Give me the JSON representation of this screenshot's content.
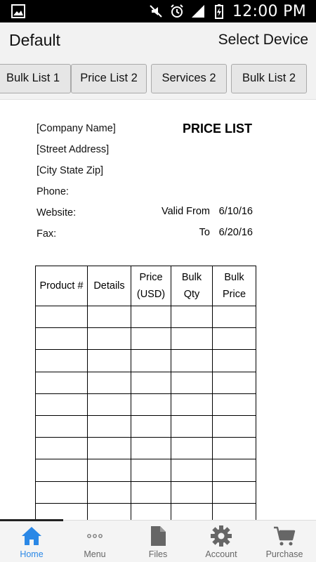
{
  "status_bar": {
    "time": "12:00 PM",
    "icons": [
      "image-icon",
      "mute-icon",
      "alarm-icon",
      "signal-icon",
      "battery-charging-icon"
    ]
  },
  "header": {
    "title": "Default",
    "select_device": "Select Device"
  },
  "tabs": [
    {
      "label": "Bulk List 1"
    },
    {
      "label": "Price List 2"
    },
    {
      "label": "Services 2"
    },
    {
      "label": "Bulk List 2"
    }
  ],
  "document": {
    "heading": "PRICE LIST",
    "company_name": "[Company Name]",
    "street_address": "[Street Address]",
    "city_state_zip": "[City State Zip]",
    "phone_label": "Phone:",
    "website_label": "Website:",
    "fax_label": "Fax:",
    "valid_from_label": "Valid From",
    "valid_from_date": "6/10/16",
    "to_label": "To",
    "to_date": "6/20/16",
    "table": {
      "headers": [
        {
          "line1": "Product #",
          "line2": ""
        },
        {
          "line1": "Details",
          "line2": ""
        },
        {
          "line1": "Price",
          "line2": "(USD)"
        },
        {
          "line1": "Bulk",
          "line2": "Qty"
        },
        {
          "line1": "Bulk",
          "line2": "Price"
        }
      ],
      "empty_rows": 10
    }
  },
  "bottom_nav": {
    "items": [
      {
        "label": "Home",
        "icon": "home-icon",
        "active": true
      },
      {
        "label": "Menu",
        "icon": "more-dots-icon",
        "active": false
      },
      {
        "label": "Files",
        "icon": "file-icon",
        "active": false
      },
      {
        "label": "Account",
        "icon": "gear-icon",
        "active": false
      },
      {
        "label": "Purchase",
        "icon": "cart-icon",
        "active": false
      }
    ]
  },
  "colors": {
    "active": "#2b88e6",
    "inactive": "#666666",
    "status_bar": "#000000"
  }
}
